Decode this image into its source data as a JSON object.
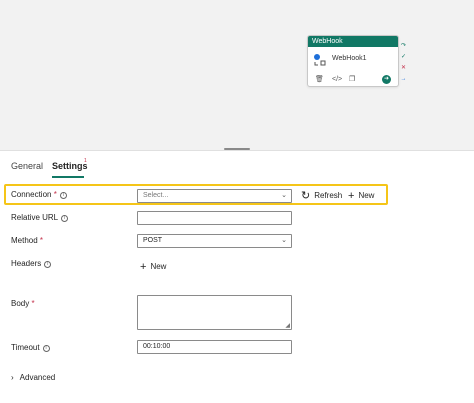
{
  "activity": {
    "type_label": "WebHook",
    "name": "WebHook1"
  },
  "tabs": [
    {
      "label": "General"
    },
    {
      "label": "Settings",
      "badge": "1"
    }
  ],
  "form": {
    "connection": {
      "label": "Connection",
      "required": "*",
      "placeholder": "Select...",
      "refresh_label": "Refresh",
      "new_label": "New"
    },
    "relative_url": {
      "label": "Relative URL",
      "value": ""
    },
    "method": {
      "label": "Method",
      "required": "*",
      "value": "POST"
    },
    "headers": {
      "label": "Headers",
      "new_label": "New"
    },
    "body": {
      "label": "Body",
      "required": "*",
      "value": ""
    },
    "timeout": {
      "label": "Timeout",
      "value": "00:10:00"
    },
    "advanced": {
      "label": "Advanced"
    }
  },
  "colors": {
    "accent": "#117865",
    "highlight": "#f5c518",
    "required": "#c4314b"
  }
}
